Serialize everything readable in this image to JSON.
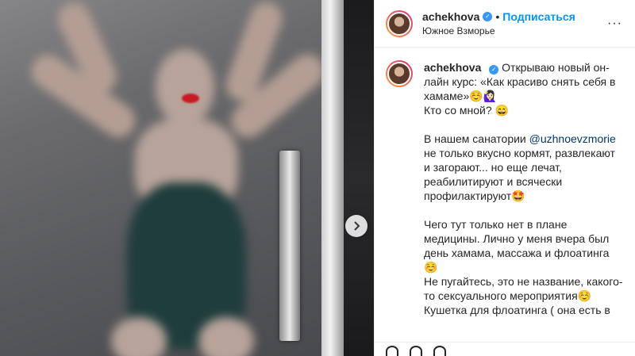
{
  "post": {
    "author": {
      "username": "achekhova",
      "location": "Южное Взморье",
      "follow_label": "Подписаться",
      "separator": "•",
      "verified": true
    },
    "more_label": "···",
    "caption": {
      "username": "achekhova",
      "p1": "Открываю новый он-лайн курс: «Как красиво снять себя в хамаме»☺️🙋🏻‍♀️",
      "p1b": "Кто со мной? 😄",
      "p2a": "В нашем санатории ",
      "mention": "@uzhnoevzmorie",
      "p2b": " не только вкусно кормят, развлекают и загорают... но еще лечат, реабилитируют и всячески профилактируют🤩",
      "p3": "Чего тут только нет в плане медицины. Лично у меня вчера был день хамама, массажа и флоатинга ☺️",
      "p4": "Не пугайтесь, это не название, какого-то сексуального мероприятия☺️",
      "p5": "Кушетка для флоатинга ( она есть в"
    },
    "carousel_next_icon": "chevron-right-icon"
  }
}
